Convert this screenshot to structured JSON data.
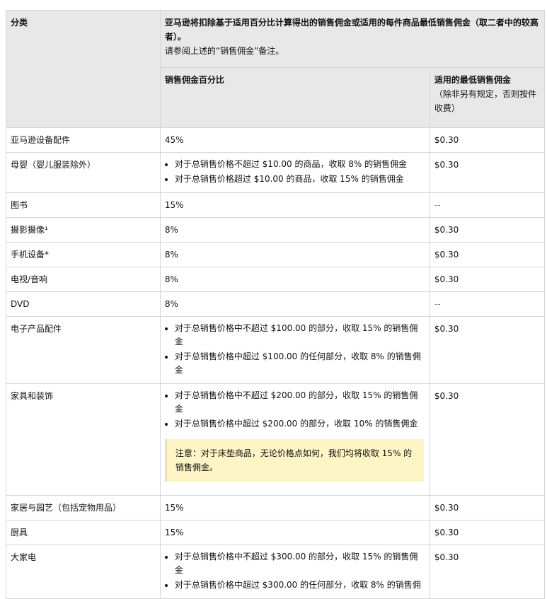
{
  "header": {
    "category": "分类",
    "main_text": "亚马逊将扣除基于适用百分比计算得出的销售佣金或适用的每件商品最低销售佣金（取二者中的较高者）。",
    "main_note": "请参阅上述的“销售佣金”备注。",
    "percent_col": "销售佣金百分比",
    "min_col": "适用的最低销售佣金",
    "min_col_note": "（除非另有规定，否则按件收费）"
  },
  "rows": [
    {
      "category": "亚马逊设备配件",
      "percent": "45%",
      "min": "$0.30"
    },
    {
      "category": "母婴（婴儿服装除外）",
      "bullets": [
        "对于总销售价格不超过 $10.00 的商品，收取 8% 的销售佣金",
        "对于总销售价格超过 $10.00 的商品，收取 15% 的销售佣金"
      ],
      "min": "$0.30"
    },
    {
      "category": "图书",
      "percent": "15%",
      "min": "--"
    },
    {
      "category": "摄影摄像¹",
      "percent": "8%",
      "min": "$0.30"
    },
    {
      "category": "手机设备*",
      "percent": "8%",
      "min": "$0.30"
    },
    {
      "category": "电视/音响",
      "percent": "8%",
      "min": "$0.30"
    },
    {
      "category": "DVD",
      "percent": "8%",
      "min": "--"
    },
    {
      "category": "电子产品配件",
      "bullets": [
        "对于总销售价格中不超过 $100.00 的部分，收取 15% 的销售佣金",
        "对于总销售价格中超过 $100.00 的任何部分，收取 8% 的销售佣金"
      ],
      "min": "$0.30"
    },
    {
      "category": "家具和装饰",
      "bullets": [
        "对于总销售价格中不超过 $200.00 的部分，收取 15% 的销售佣金",
        "对于总销售价格中超过 $200.00 的部分，收取 10% 的销售佣金"
      ],
      "note": "注意：对于床垫商品，无论价格点如何，我们均将收取 15% 的销售佣金。",
      "min": "$0.30"
    },
    {
      "category": "家居与园艺（包括宠物用品）",
      "percent": "15%",
      "min": "$0.30"
    },
    {
      "category": "厨具",
      "percent": "15%",
      "min": "$0.30"
    },
    {
      "category": "大家电",
      "bullets": [
        "对于总销售价格中不超过 $300.00 的部分，收取 15% 的销售佣金",
        "对于总销售价格中超过 $300.00 的任何部分，收取 8% 的销售佣"
      ],
      "min": "$0.30"
    }
  ]
}
